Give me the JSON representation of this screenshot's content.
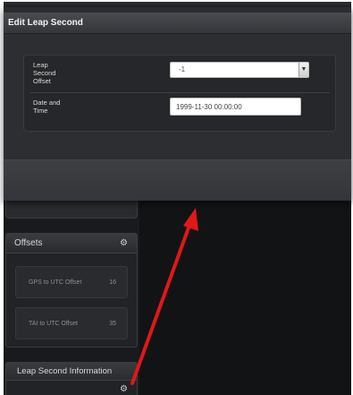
{
  "modal": {
    "title": "Edit Leap Second",
    "fields": {
      "offset_label": "Leap\nSecond\nOffset",
      "offset_value": "-1",
      "datetime_label": "Date and\nTime",
      "datetime_value": "1999-11-30 00:00:00"
    }
  },
  "offsets_panel": {
    "title": "Offsets",
    "rows": [
      {
        "label": "GPS to UTC Offset",
        "value": "16"
      },
      {
        "label": "TAI to UTC Offset",
        "value": "35"
      }
    ]
  },
  "leap_panel": {
    "title": "Leap Second Information"
  },
  "icons": {
    "settings": "gear-icon",
    "dropdown": "chevron-down-icon"
  },
  "colors": {
    "annotation_arrow": "#e01818"
  }
}
